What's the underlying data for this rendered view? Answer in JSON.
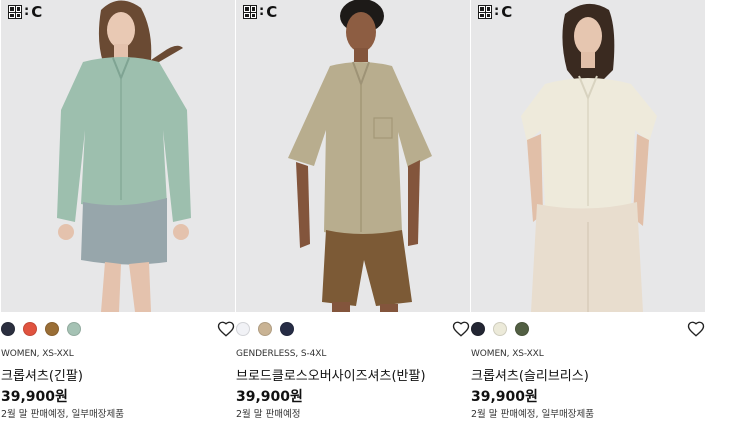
{
  "brand": {
    "logo_c": "C"
  },
  "products": [
    {
      "fit_size": "WOMEN, XS-XXL",
      "name": "크롭셔츠(긴팔)",
      "price": "39,900원",
      "note": "2월 말 판매예정, 일부매장제품",
      "swatches": [
        "#2b2f3f",
        "#e0533f",
        "#9a6e36",
        "#a5c2b4"
      ],
      "garment_color": "#9dbfae",
      "bottom_color": "#97a6ab"
    },
    {
      "fit_size": "GENDERLESS, S-4XL",
      "name": "브로드클로스오버사이즈셔츠(반팔)",
      "price": "39,900원",
      "note": "2월 말 판매예정",
      "swatches": [
        "#f1f2f6",
        "#c9b394",
        "#262c45"
      ],
      "garment_color": "#b8ad8e",
      "bottom_color": "#7c5a36"
    },
    {
      "fit_size": "WOMEN, XS-XXL",
      "name": "크롭셔츠(슬리브리스)",
      "price": "39,900원",
      "note": "2월 말 판매예정, 일부매장제품",
      "swatches": [
        "#232633",
        "#ecead9",
        "#525f43"
      ],
      "garment_color": "#eeeadb",
      "bottom_color": "#e8ddce"
    }
  ],
  "icons": {
    "favorite": "heart-outline-icon"
  }
}
